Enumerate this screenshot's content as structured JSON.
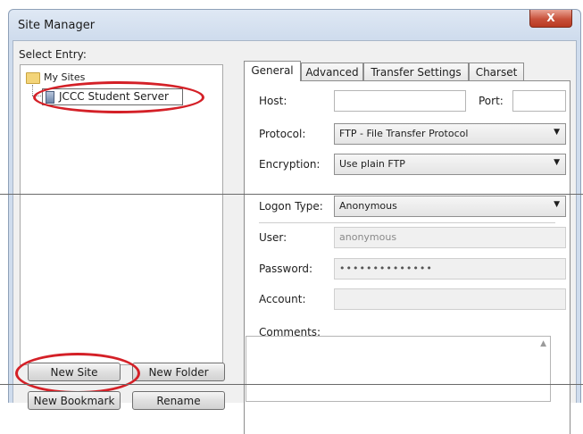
{
  "window": {
    "title": "Site Manager",
    "close_label": "X"
  },
  "sidebar": {
    "select_label": "Select Entry:",
    "tree": {
      "root": "My Sites",
      "child": "JCCC Student Server"
    },
    "buttons": {
      "new_site": "New Site",
      "new_folder": "New Folder",
      "new_bookmark": "New Bookmark",
      "rename": "Rename"
    }
  },
  "tabs": [
    "General",
    "Advanced",
    "Transfer Settings",
    "Charset"
  ],
  "general": {
    "host_label": "Host:",
    "host_value": "",
    "port_label": "Port:",
    "port_value": "",
    "protocol_label": "Protocol:",
    "protocol_value": "FTP - File Transfer Protocol",
    "encryption_label": "Encryption:",
    "encryption_value": "Use plain FTP",
    "logon_type_label": "Logon Type:",
    "logon_type_value": "Anonymous",
    "user_label": "User:",
    "user_value": "anonymous",
    "password_label": "Password:",
    "password_value": "••••••••••••••",
    "account_label": "Account:",
    "account_value": "",
    "comments_label": "Comments:"
  },
  "colors": {
    "highlight": "#d42027",
    "titlebar": "#cfdced",
    "close_button": "#c8503a"
  },
  "icons": [
    "folder-icon",
    "server-icon",
    "close-icon",
    "dropdown-arrow-icon",
    "scroll-up-icon"
  ]
}
